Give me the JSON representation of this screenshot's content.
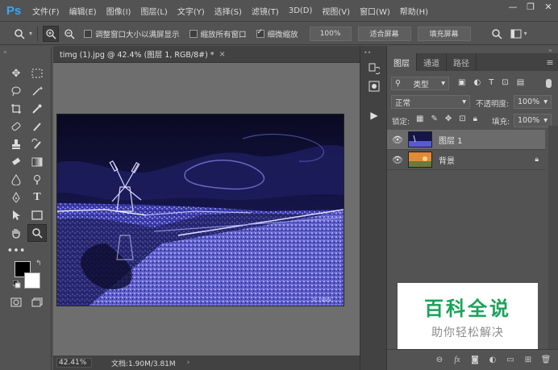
{
  "app": {
    "logo": "Ps"
  },
  "menubar": {
    "items": [
      "文件(F)",
      "编辑(E)",
      "图像(I)",
      "图层(L)",
      "文字(Y)",
      "选择(S)",
      "滤镜(T)",
      "3D(D)",
      "视图(V)",
      "窗口(W)",
      "帮助(H)"
    ]
  },
  "window_controls": {
    "minimize": "—",
    "restore": "❐",
    "close": "✕"
  },
  "options_bar": {
    "resize_windows_label": "调整窗口大小以满屏显示",
    "zoom_all_windows_label": "缩放所有窗口",
    "scrubby_zoom_label": "细微缩放",
    "zoom_percent": "100%",
    "fit_screen_label": "适合屏幕",
    "fill_screen_label": "填充屏幕",
    "resize_checked": false,
    "zoom_all_checked": false,
    "scrubby_checked": true
  },
  "document": {
    "tab_title": "timg (1).jpg @ 42.4% (图层 1, RGB/8#) *",
    "close": "×",
    "zoom_readout": "42.41%",
    "doc_size": "文档:1.90M/3.81M",
    "status_arrow": "›"
  },
  "layers_panel": {
    "tabs": [
      "图层",
      "通道",
      "路径"
    ],
    "active_tab": 0,
    "filter_kind": "类型",
    "blend_mode": "正常",
    "opacity_label": "不透明度:",
    "opacity_value": "100%",
    "lock_label": "锁定:",
    "fill_label": "填充:",
    "fill_value": "100%",
    "layers": [
      {
        "name": "图层 1",
        "visible": true,
        "selected": true,
        "locked": false
      },
      {
        "name": "背景",
        "visible": true,
        "selected": false,
        "locked": true
      }
    ]
  },
  "watermark": {
    "title": "百科全说",
    "subtitle": "助你轻松解决"
  },
  "colors": {
    "accent": "#31a8ff",
    "panel_bg": "#535353",
    "canvas_bg": "#6e6e6e",
    "watermark_green": "#1aa35a"
  }
}
